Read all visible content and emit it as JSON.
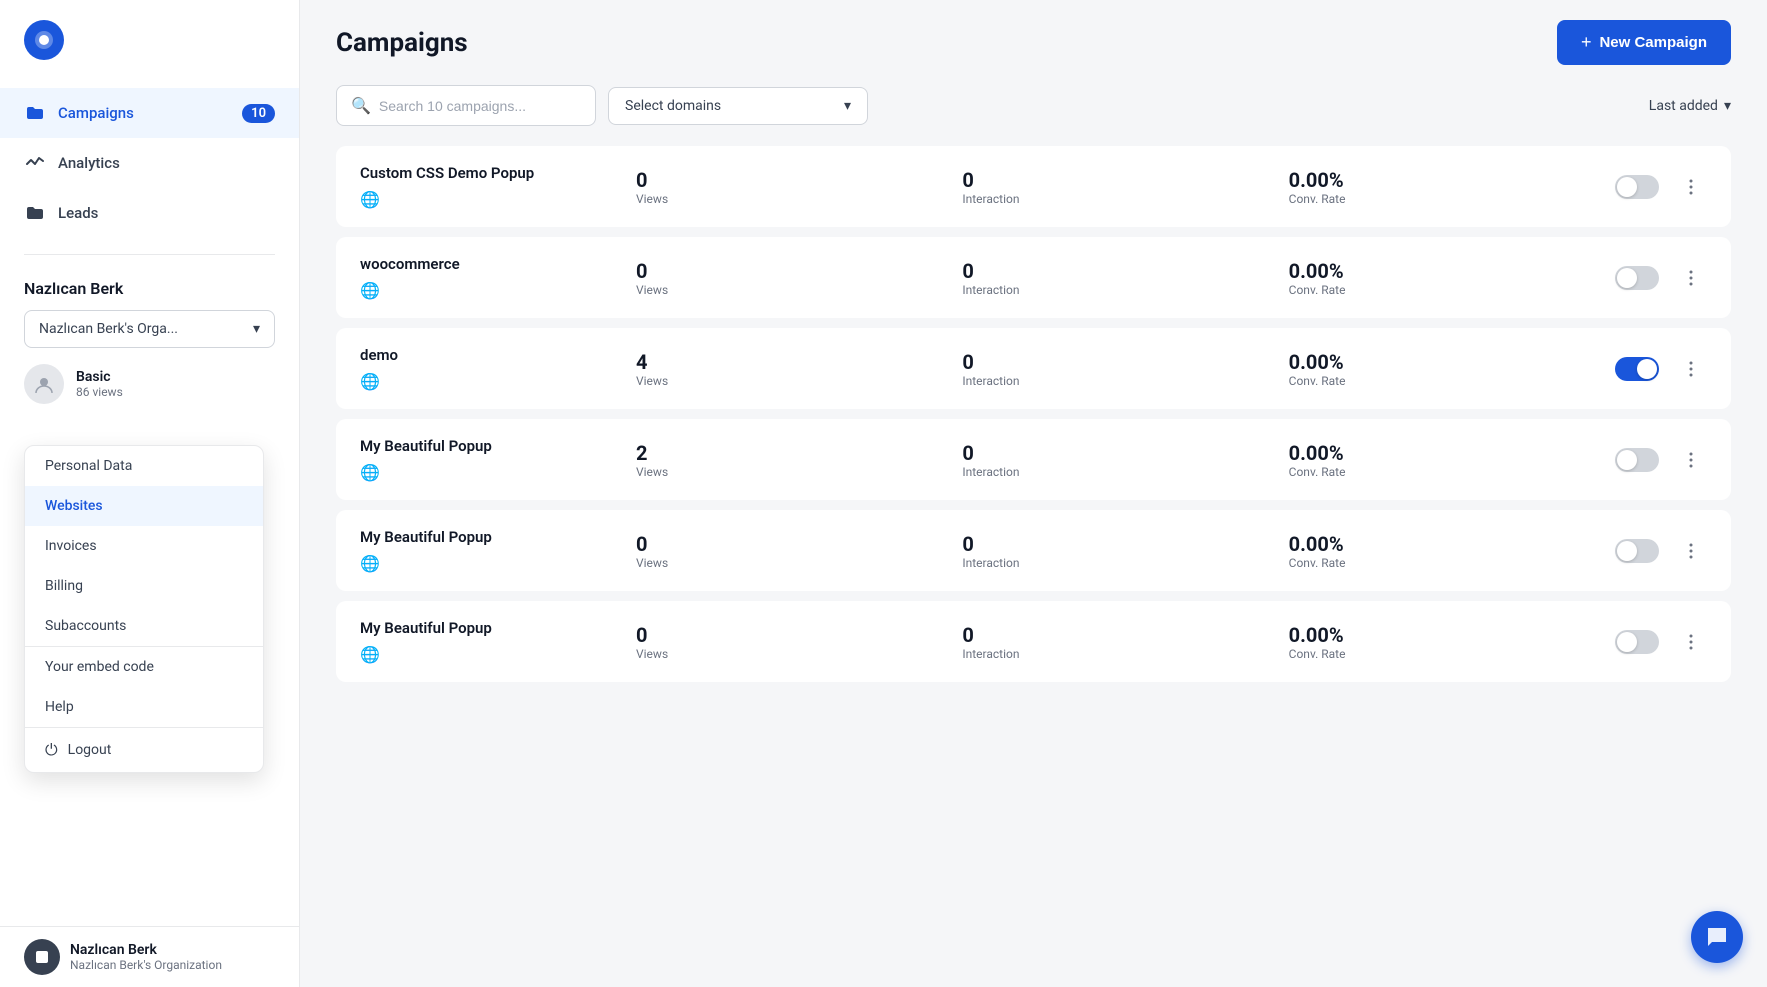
{
  "app": {
    "logo_letter": "●"
  },
  "sidebar": {
    "nav_items": [
      {
        "id": "campaigns",
        "label": "Campaigns",
        "icon": "folder",
        "badge": "10",
        "active": true
      },
      {
        "id": "analytics",
        "label": "Analytics",
        "icon": "chart"
      },
      {
        "id": "leads",
        "label": "Leads",
        "icon": "folder"
      }
    ],
    "user": {
      "name": "Nazlıcan Berk",
      "org_label": "Nazlıcan Berk's Orga...",
      "plan": "Basic",
      "plan_views": "86 views"
    },
    "dropdown_items": [
      {
        "id": "personal-data",
        "label": "Personal Data",
        "active": false
      },
      {
        "id": "websites",
        "label": "Websites",
        "active": true
      },
      {
        "id": "invoices",
        "label": "Invoices",
        "active": false
      },
      {
        "id": "billing",
        "label": "Billing",
        "active": false
      },
      {
        "id": "subaccounts",
        "label": "Subaccounts",
        "active": false
      }
    ],
    "footer_links": [
      {
        "id": "embed-code",
        "label": "Your embed code"
      },
      {
        "id": "help",
        "label": "Help"
      }
    ],
    "logout_label": "Logout",
    "bottom_user": {
      "name": "Nazlıcan Berk",
      "org": "Nazlıcan Berk's Organization"
    }
  },
  "header": {
    "title": "Campaigns",
    "new_campaign_label": "+ New Campaign"
  },
  "filters": {
    "search_placeholder": "Search 10 campaigns...",
    "domain_select_label": "Select domains",
    "sort_label": "Last added"
  },
  "campaigns": [
    {
      "id": 1,
      "name": "Custom CSS Demo Popup",
      "views": "0",
      "interaction": "0",
      "conv_rate": "0.00%",
      "enabled": false
    },
    {
      "id": 2,
      "name": "woocommerce",
      "views": "0",
      "interaction": "0",
      "conv_rate": "0.00%",
      "enabled": false
    },
    {
      "id": 3,
      "name": "demo",
      "views": "4",
      "interaction": "0",
      "conv_rate": "0.00%",
      "enabled": true
    },
    {
      "id": 4,
      "name": "My Beautiful Popup",
      "views": "2",
      "interaction": "0",
      "conv_rate": "0.00%",
      "enabled": false
    },
    {
      "id": 5,
      "name": "My Beautiful Popup",
      "views": "0",
      "interaction": "0",
      "conv_rate": "0.00%",
      "enabled": false
    },
    {
      "id": 6,
      "name": "My Beautiful Popup",
      "views": "0",
      "interaction": "0",
      "conv_rate": "0.00%",
      "enabled": false
    }
  ],
  "labels": {
    "views": "Views",
    "interaction": "Interaction",
    "conv_rate": "Conv. Rate"
  }
}
